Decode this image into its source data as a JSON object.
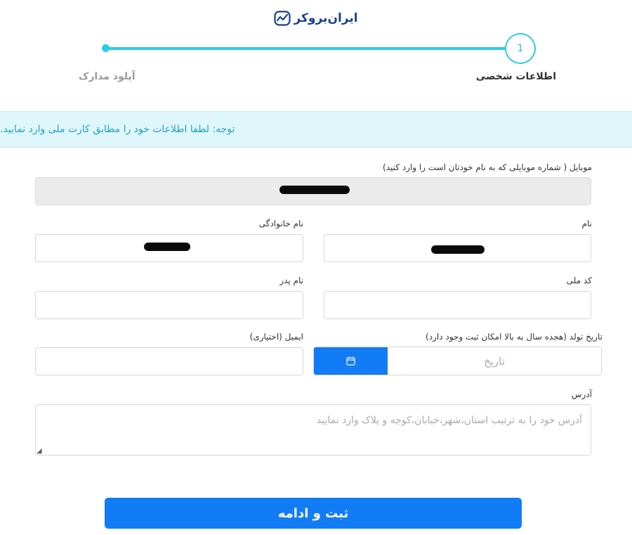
{
  "brand": {
    "name": "ایران‌بروکر"
  },
  "stepper": {
    "active_step_number": "1",
    "steps": [
      {
        "label": "اطلاعات شخصی"
      },
      {
        "label": "آپلود مدارک"
      }
    ]
  },
  "notice": {
    "text": "توجه: لطفا اطلاعات خود را مطابق کارت ملی وارد نمایید."
  },
  "form": {
    "mobile": {
      "label": "موبایل ( شماره موبایلی که به نام خودتان است را وارد کنید)",
      "value": ""
    },
    "first_name": {
      "label": "نام",
      "value": ""
    },
    "last_name": {
      "label": "نام خانوادگی",
      "value": ""
    },
    "national_code": {
      "label": "کد ملی",
      "value": ""
    },
    "father_name": {
      "label": "نام پدر",
      "value": ""
    },
    "birth_date": {
      "label": "تاریخ تولد (هجده سال به بالا امکان ثبت وجود دارد)",
      "placeholder": "تاریخ"
    },
    "email": {
      "label": "ایمیل (اختیاری)",
      "value": ""
    },
    "address": {
      "label": "آدرس",
      "placeholder": "آدرس خود را به ترتیب استان،شهر،خیابان،کوچه و پلاک وارد نمایید"
    },
    "submit_label": "ثبت و ادامه"
  },
  "colors": {
    "accent": "#127cf7",
    "stepper": "#2bcbe8",
    "brand": "#1c3f94",
    "notice_bg": "#dff6fb",
    "notice_text": "#20a5c0"
  }
}
